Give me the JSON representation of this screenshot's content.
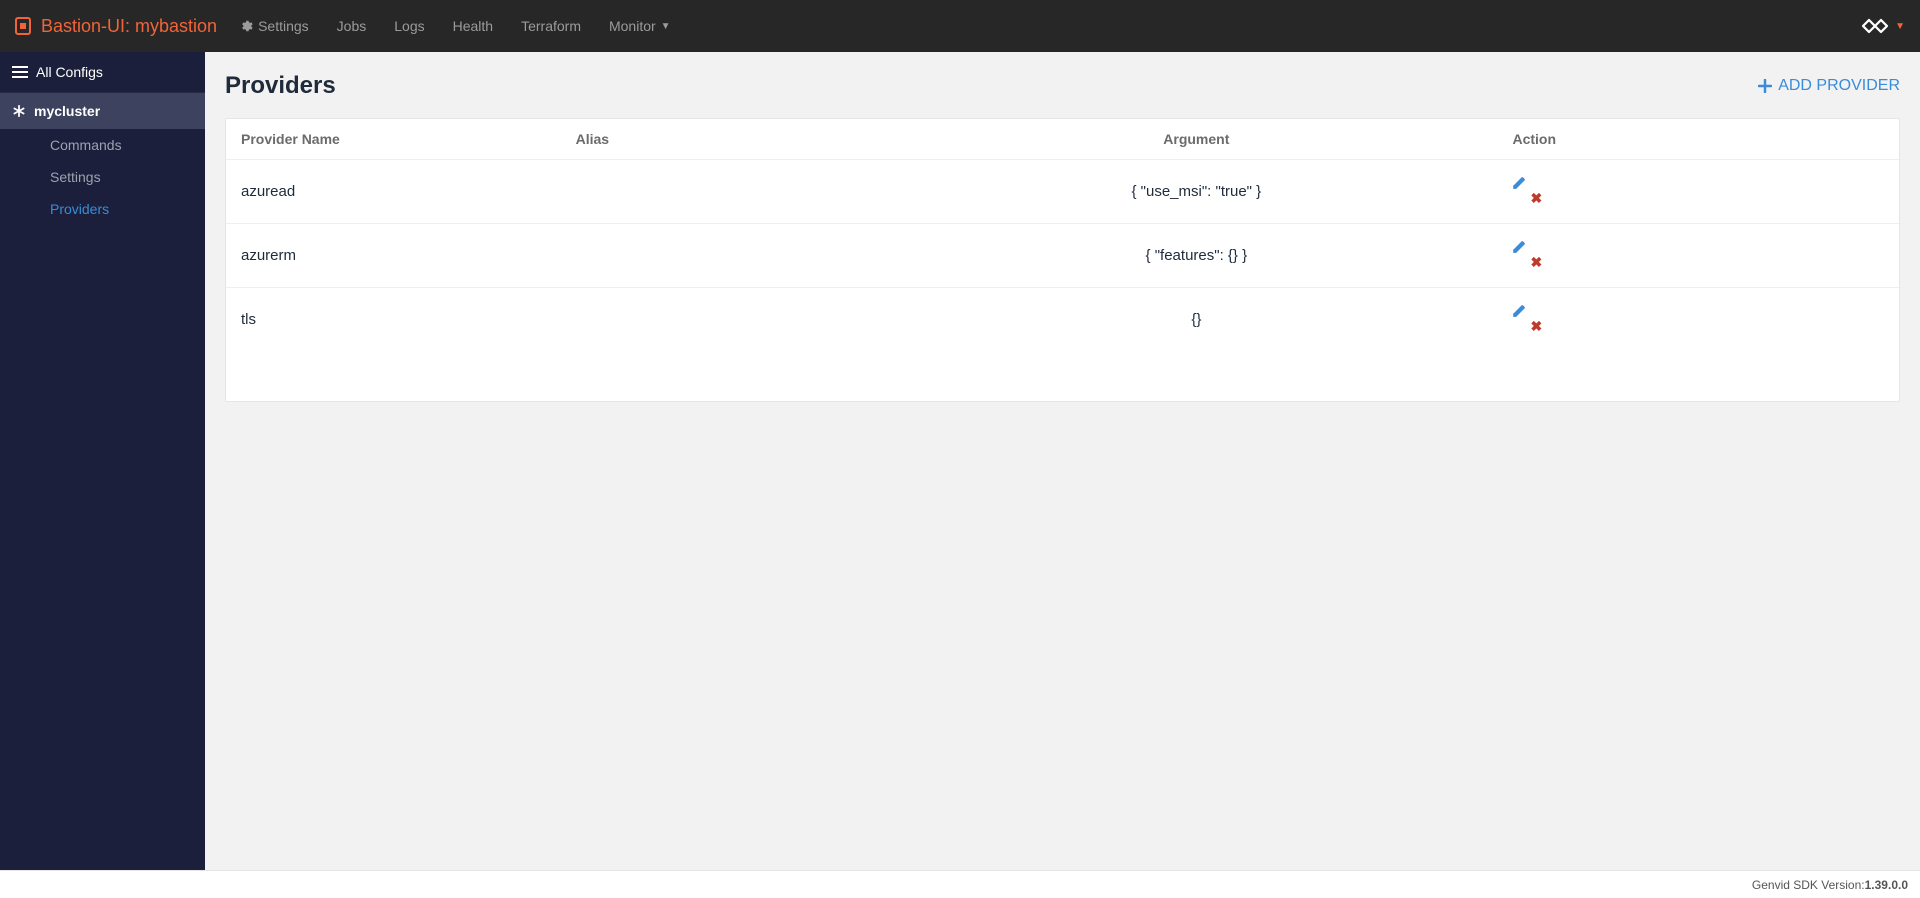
{
  "navbar": {
    "brand_label": "Bastion-UI: mybastion",
    "links": {
      "settings": "Settings",
      "jobs": "Jobs",
      "logs": "Logs",
      "health": "Health",
      "terraform": "Terraform",
      "monitor": "Monitor"
    }
  },
  "sidebar": {
    "all_configs": "All Configs",
    "cluster": "mycluster",
    "items": {
      "commands": "Commands",
      "settings": "Settings",
      "providers": "Providers"
    }
  },
  "page": {
    "title": "Providers",
    "add_button": "ADD PROVIDER"
  },
  "table": {
    "headers": {
      "name": "Provider Name",
      "alias": "Alias",
      "argument": "Argument",
      "action": "Action"
    },
    "rows": [
      {
        "name": "azuread",
        "alias": "",
        "argument": "{ \"use_msi\": \"true\" }"
      },
      {
        "name": "azurerm",
        "alias": "",
        "argument": "{ \"features\": {} }"
      },
      {
        "name": "tls",
        "alias": "",
        "argument": "{}"
      }
    ]
  },
  "footer": {
    "label": "Genvid SDK Version: ",
    "version": "1.39.0.0"
  }
}
